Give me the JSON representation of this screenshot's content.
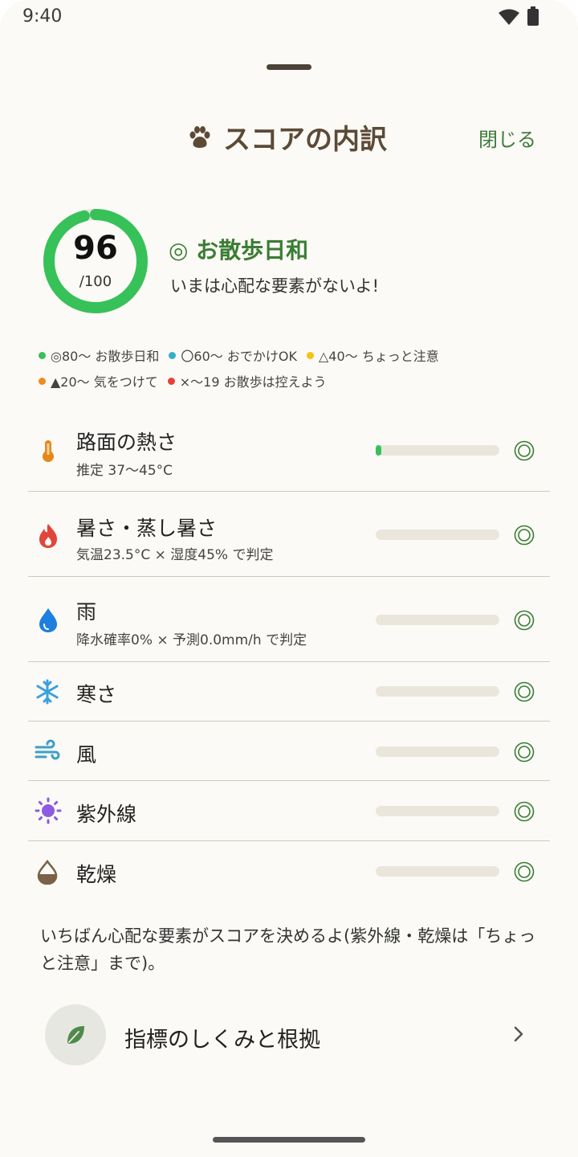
{
  "status_bar": {
    "time": "9:40"
  },
  "header": {
    "title": "スコアの内訳",
    "close_label": "閉じる"
  },
  "score": {
    "value": "96",
    "max_label": "/100",
    "fraction": 0.96,
    "rating": "◎ お散歩日和",
    "message": "いまは心配な要素がないよ!"
  },
  "legend": [
    {
      "label": "◎80〜 お散歩日和",
      "color": "#37c159"
    },
    {
      "label": "〇60〜 おでかけOK",
      "color": "#35aec9"
    },
    {
      "label": "△40〜 ちょっと注意",
      "color": "#f3c512"
    },
    {
      "label": "▲20〜 気をつけて",
      "color": "#ef8a1d"
    },
    {
      "label": "×〜19 お散歩は控えよう",
      "color": "#e74033"
    }
  ],
  "factors": [
    {
      "name": "路面の熱さ",
      "detail": "推定 37〜45°C",
      "icon": "thermometer-icon",
      "level": 0.04,
      "rating": "◎"
    },
    {
      "name": "暑さ・蒸し暑さ",
      "detail": "気温23.5°C × 湿度45% で判定",
      "icon": "flame-icon",
      "level": 0,
      "rating": "◎"
    },
    {
      "name": "雨",
      "detail": "降水確率0% × 予測0.0mm/h で判定",
      "icon": "raindrop-icon",
      "level": 0,
      "rating": "◎"
    },
    {
      "name": "寒さ",
      "detail": "",
      "icon": "snowflake-icon",
      "level": 0,
      "rating": "◎"
    },
    {
      "name": "風",
      "detail": "",
      "icon": "wind-icon",
      "level": 0,
      "rating": "◎"
    },
    {
      "name": "紫外線",
      "detail": "",
      "icon": "sun-icon",
      "level": 0,
      "rating": "◎"
    },
    {
      "name": "乾燥",
      "detail": "",
      "icon": "dry-drop-icon",
      "level": 0,
      "rating": "◎"
    }
  ],
  "note": "いちばん心配な要素がスコアを決めるよ(紫外線・乾燥は「ちょっと注意」まで)。",
  "guide": {
    "label": "指標のしくみと根拠",
    "icon": "leaf-icon"
  },
  "colors": {
    "accent": "#3a7d34",
    "ring": "#37c159",
    "title": "#5c4a36",
    "bar_track": "#ebe6db"
  }
}
